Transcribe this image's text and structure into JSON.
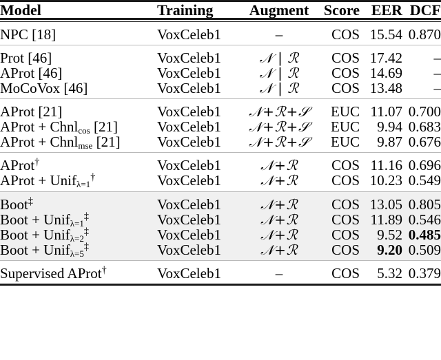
{
  "table": {
    "columns": [
      {
        "key": "model",
        "label": "Model",
        "align": "left"
      },
      {
        "key": "training",
        "label": "Training",
        "align": "left"
      },
      {
        "key": "augment",
        "label": "Augment",
        "align": "center"
      },
      {
        "key": "score",
        "label": "Score",
        "align": "right"
      },
      {
        "key": "eer",
        "label": "EER",
        "align": "right"
      },
      {
        "key": "dcf",
        "label": "DCF",
        "align": "right"
      }
    ],
    "highlight_color": "#f0f0f0",
    "sections": [
      {
        "id": "section-npc",
        "highlight": false,
        "rows": [
          {
            "model": "NPC [18]",
            "model_ref": "18",
            "training": "VoxCeleb1",
            "augment": "–",
            "augment_kind": "dash",
            "score": "COS",
            "eer": "15.54",
            "dcf": "0.870",
            "eer_bold": false,
            "dcf_bold": false
          }
        ]
      },
      {
        "id": "section-prot",
        "highlight": false,
        "rows": [
          {
            "model": "Prot [46]",
            "model_ref": "46",
            "training": "VoxCeleb1",
            "augment": "N | R",
            "augment_kind": "NR",
            "score": "COS",
            "eer": "17.42",
            "dcf": "–",
            "eer_bold": false,
            "dcf_bold": false
          },
          {
            "model": "AProt [46]",
            "model_ref": "46",
            "training": "VoxCeleb1",
            "augment": "N | R",
            "augment_kind": "NR",
            "score": "COS",
            "eer": "14.69",
            "dcf": "–",
            "eer_bold": false,
            "dcf_bold": false
          },
          {
            "model": "MoCoVox [46]",
            "model_ref": "46",
            "training": "VoxCeleb1",
            "augment": "N | R",
            "augment_kind": "NR",
            "score": "COS",
            "eer": "13.48",
            "dcf": "–",
            "eer_bold": false,
            "dcf_bold": false
          }
        ]
      },
      {
        "id": "section-aprot-chnl",
        "highlight": false,
        "rows": [
          {
            "model": "AProt [21]",
            "model_ref": "21",
            "training": "VoxCeleb1",
            "augment": "N+R+S",
            "augment_kind": "NRS",
            "score": "EUC",
            "eer": "11.07",
            "dcf": "0.700",
            "eer_bold": false,
            "dcf_bold": false
          },
          {
            "model": "AProt + Chnl",
            "model_sub": "cos",
            "model_tail": " [21]",
            "model_ref": "21",
            "training": "VoxCeleb1",
            "augment": "N+R+S",
            "augment_kind": "NRS",
            "score": "EUC",
            "eer": "9.94",
            "dcf": "0.683",
            "eer_bold": false,
            "dcf_bold": false
          },
          {
            "model": "AProt + Chnl",
            "model_sub": "mse",
            "model_tail": " [21]",
            "model_ref": "21",
            "training": "VoxCeleb1",
            "augment": "N+R+S",
            "augment_kind": "NRS",
            "score": "EUC",
            "eer": "9.87",
            "dcf": "0.676",
            "eer_bold": false,
            "dcf_bold": false
          }
        ]
      },
      {
        "id": "section-aprot-unif",
        "highlight": false,
        "rows": [
          {
            "model": "AProt",
            "model_sup": "†",
            "training": "VoxCeleb1",
            "augment": "N+R",
            "augment_kind": "NRplus",
            "score": "COS",
            "eer": "11.16",
            "dcf": "0.696",
            "eer_bold": false,
            "dcf_bold": false
          },
          {
            "model": "AProt + Unif",
            "model_sub": "λ=1",
            "model_sup": "†",
            "training": "VoxCeleb1",
            "augment": "N+R",
            "augment_kind": "NRplus",
            "score": "COS",
            "eer": "10.23",
            "dcf": "0.549",
            "eer_bold": false,
            "dcf_bold": false
          }
        ]
      },
      {
        "id": "section-boot",
        "highlight": true,
        "rows": [
          {
            "model": "Boot",
            "model_sup": "‡",
            "training": "VoxCeleb1",
            "augment": "N+R",
            "augment_kind": "NRplus",
            "score": "COS",
            "eer": "13.05",
            "dcf": "0.805",
            "eer_bold": false,
            "dcf_bold": false
          },
          {
            "model": "Boot + Unif",
            "model_sub": "λ=1",
            "model_sup": "‡",
            "training": "VoxCeleb1",
            "augment": "N+R",
            "augment_kind": "NRplus",
            "score": "COS",
            "eer": "11.89",
            "dcf": "0.546",
            "eer_bold": false,
            "dcf_bold": false
          },
          {
            "model": "Boot + Unif",
            "model_sub": "λ=2",
            "model_sup": "‡",
            "training": "VoxCeleb1",
            "augment": "N+R",
            "augment_kind": "NRplus",
            "score": "COS",
            "eer": "9.52",
            "dcf": "0.485",
            "eer_bold": false,
            "dcf_bold": true
          },
          {
            "model": "Boot + Unif",
            "model_sub": "λ=5",
            "model_sup": "‡",
            "training": "VoxCeleb1",
            "augment": "N+R",
            "augment_kind": "NRplus",
            "score": "COS",
            "eer": "9.20",
            "dcf": "0.509",
            "eer_bold": true,
            "dcf_bold": false
          }
        ]
      },
      {
        "id": "section-supervised",
        "highlight": false,
        "rows": [
          {
            "model": "Supervised AProt",
            "model_sup": "†",
            "training": "VoxCeleb1",
            "augment": "–",
            "augment_kind": "dash",
            "score": "COS",
            "eer": "5.32",
            "dcf": "0.379",
            "eer_bold": false,
            "dcf_bold": false
          }
        ]
      }
    ],
    "symbols": {
      "cal_N": "𝒩",
      "cal_R": "ℛ",
      "cal_S": "𝒮",
      "pipe": "|",
      "plus": "+",
      "en_dash": "–",
      "dagger": "†",
      "ddagger": "‡",
      "lambda": "λ"
    }
  }
}
